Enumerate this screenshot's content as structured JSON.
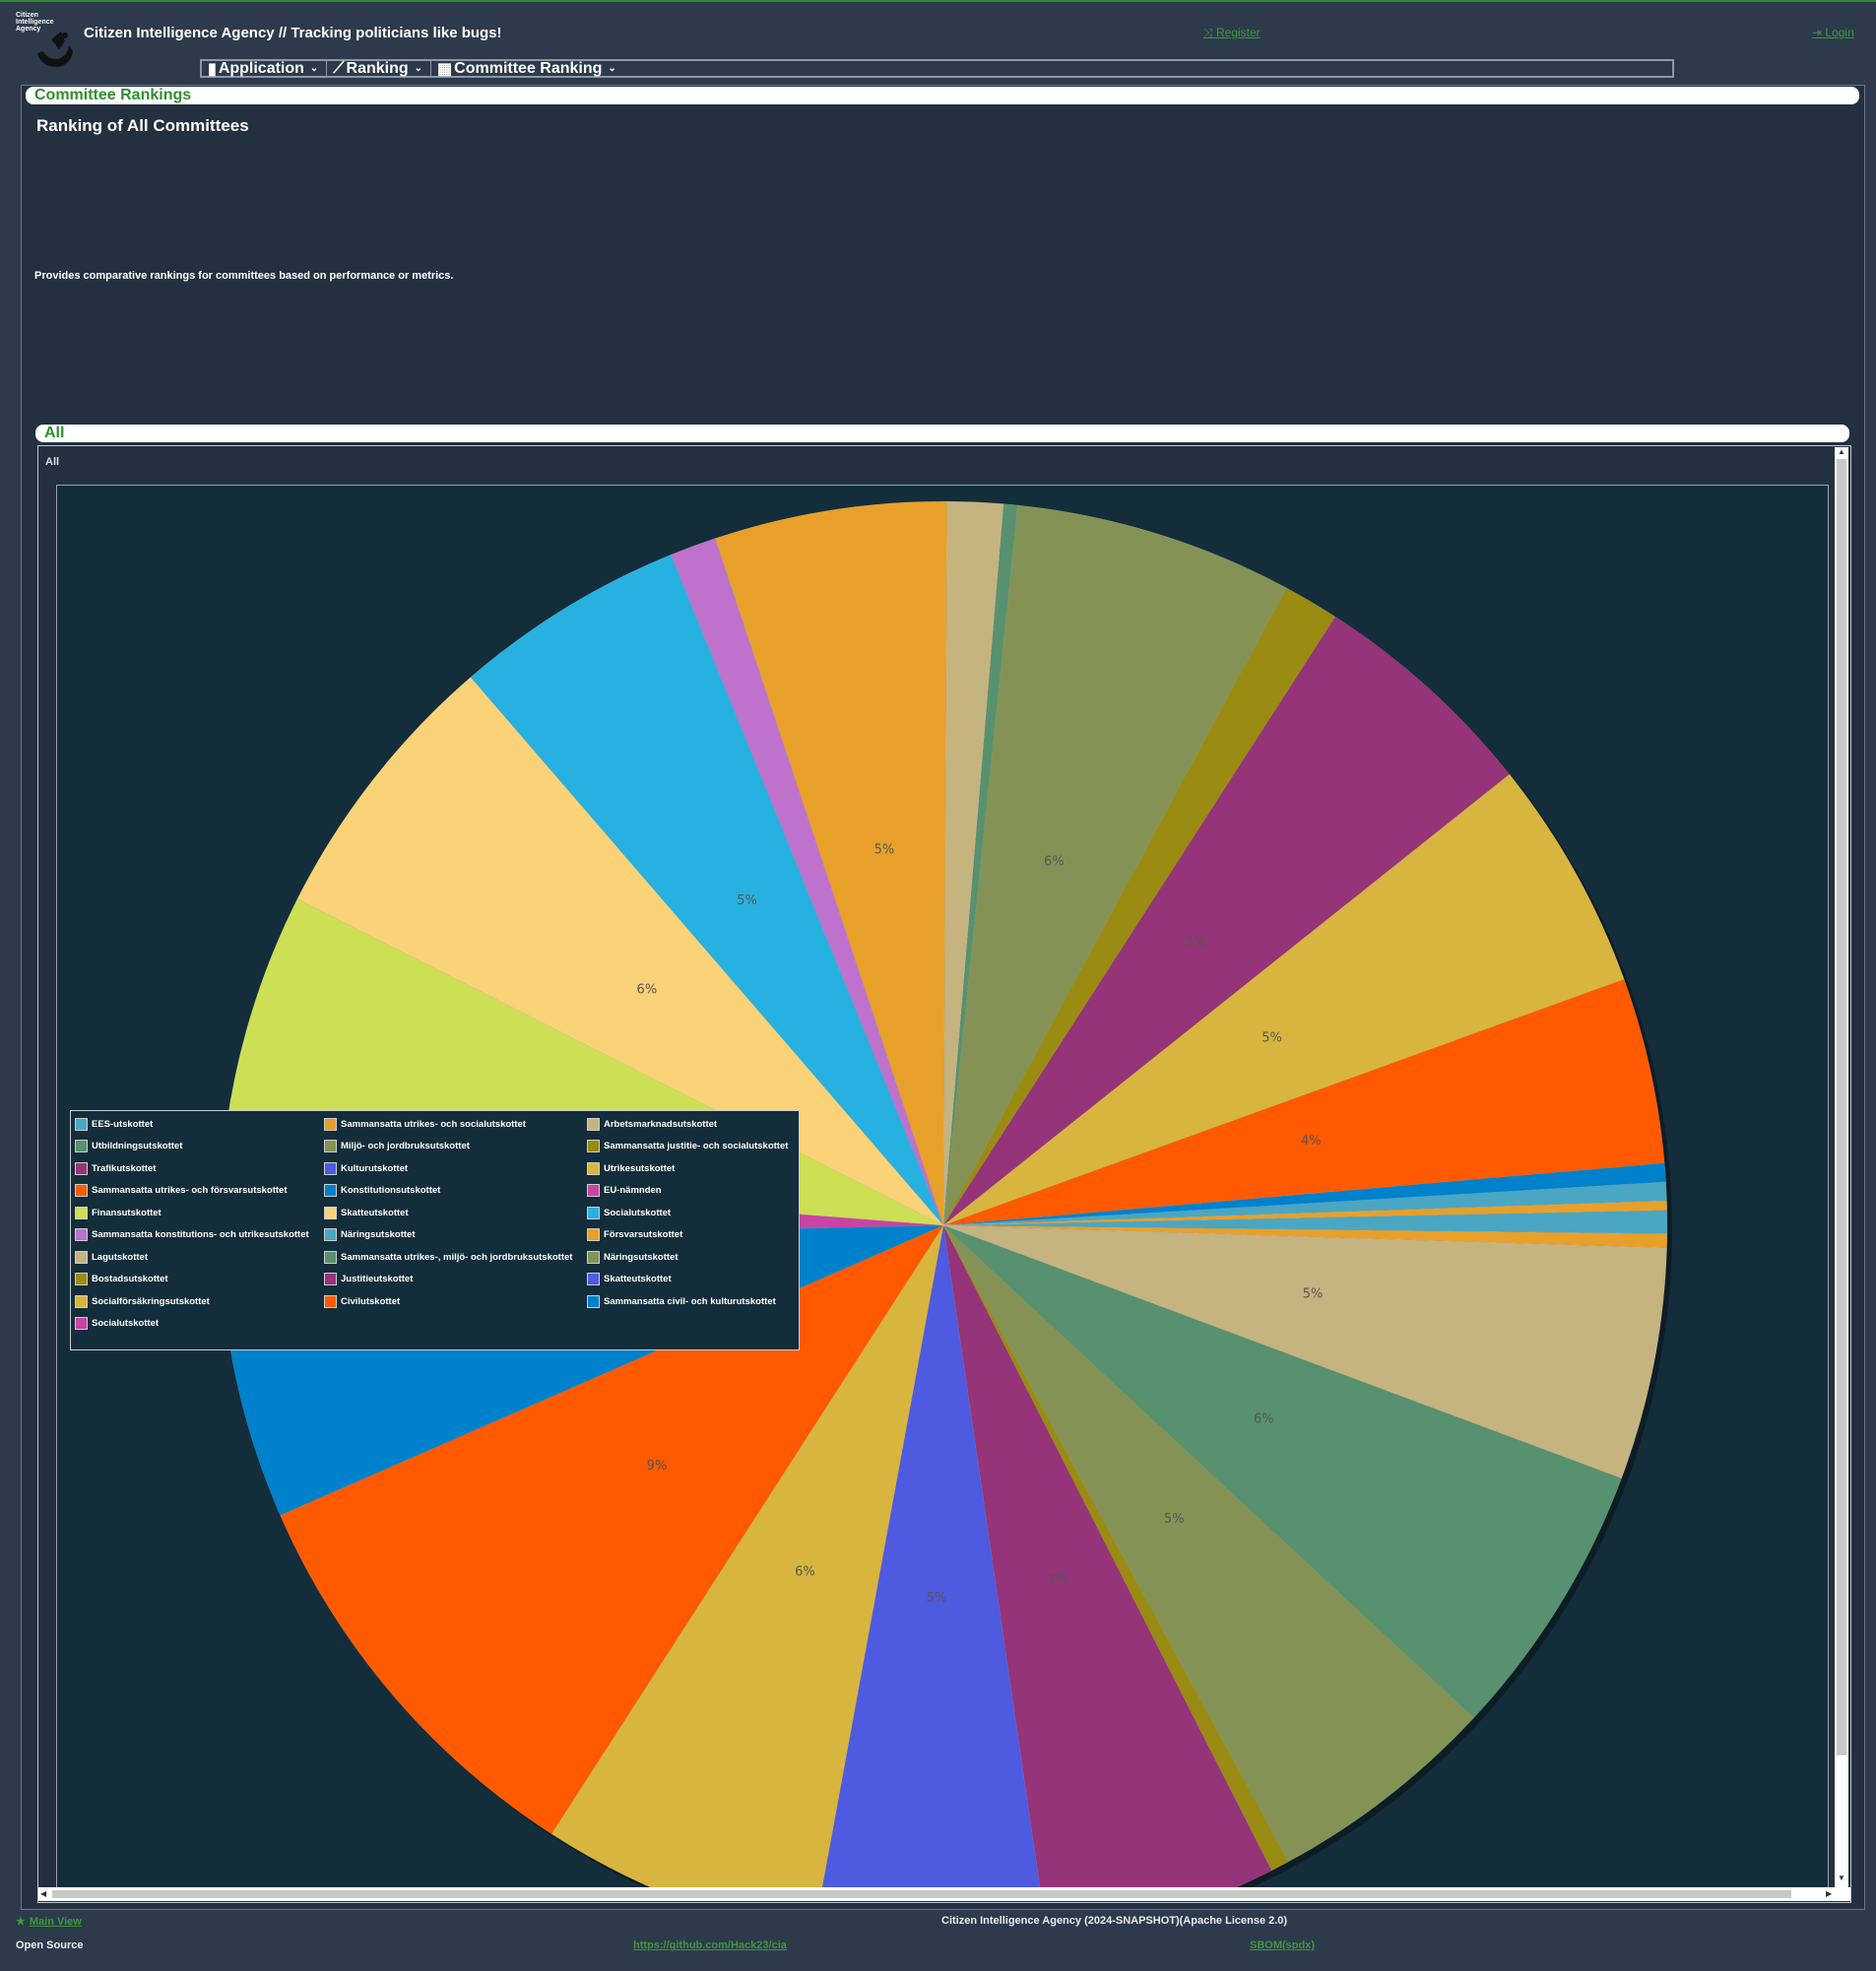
{
  "header": {
    "logo_text": "Citizen Intelligence Agency",
    "title": "Citizen Intelligence Agency",
    "tagline": " // Tracking politicians like bugs!",
    "register_label": "Register",
    "login_label": "Login"
  },
  "menu": [
    {
      "label": "Application",
      "icon": "document-icon"
    },
    {
      "label": "Ranking",
      "icon": "line-chart-icon"
    },
    {
      "label": "Committee Ranking",
      "icon": "building-icon"
    }
  ],
  "main": {
    "panel_caption": "Committee Rankings",
    "heading": "Ranking of All Committees",
    "description": "Provides comparative rankings for committees based on performance or metrics.",
    "chart_panel_caption": "All",
    "chart_label": "All"
  },
  "chart_data": {
    "type": "pie",
    "slices": [
      {
        "name": "EES-utskottet",
        "value": 0.5,
        "color": "#4aa6c2"
      },
      {
        "name": "Sammansatta utrikes- och socialutskottet",
        "value": 0.3,
        "color": "#e8a02a"
      },
      {
        "name": "Arbetsmarknadsutskottet",
        "value": 5,
        "color": "#c5b380",
        "label": "5%"
      },
      {
        "name": "Utbildningsutskottet",
        "value": 6,
        "color": "#57916f",
        "label": "6%"
      },
      {
        "name": "Miljö- och jordbruksutskottet",
        "value": 5,
        "color": "#849355",
        "label": "5%"
      },
      {
        "name": "Sammansatta justitie- och socialutskottet",
        "value": 0.4,
        "color": "#9a8b12"
      },
      {
        "name": "Trafikutskottet",
        "value": 5,
        "color": "#953478",
        "label": "5%"
      },
      {
        "name": "Kulturutskottet",
        "value": 5,
        "color": "#4e5ae0",
        "label": "5%"
      },
      {
        "name": "Utrikesutskottet",
        "value": 6,
        "color": "#d8b53e",
        "label": "6%"
      },
      {
        "name": "Sammansatta utrikes- och försvarsutskottet",
        "value": 9,
        "color": "#ff5a00",
        "label": "9%"
      },
      {
        "name": "Konstitutionsutskottet",
        "value": 6,
        "color": "#0081cc"
      },
      {
        "name": "EU-nämnden",
        "value": 1.5,
        "color": "#c944a4"
      },
      {
        "name": "Finansutskottet",
        "value": 6,
        "color": "#cddf55",
        "label": "6%"
      },
      {
        "name": "Skatteutskottet",
        "value": 6,
        "color": "#fad277",
        "label": "6%"
      },
      {
        "name": "Socialutskottet",
        "value": 5,
        "color": "#27b1e0",
        "label": "5%"
      },
      {
        "name": "Sammansatta konstitutions- och utrikesutskottet",
        "value": 1,
        "color": "#be72cc"
      },
      {
        "name": "Näringsutskottet",
        "value": 5,
        "color": "#e8a02a",
        "label": "5%"
      },
      {
        "name": "Försvarsutskottet",
        "value": 1.2,
        "color": "#c5b380"
      },
      {
        "name": "Lagutskottet",
        "value": 0.3,
        "color": "#57916f"
      },
      {
        "name": "Sammansatta utrikes-, miljö- och jordbruksutskottet",
        "value": 6,
        "color": "#849355",
        "label": "6%"
      },
      {
        "name": "Näringsutskottet",
        "value": 1.2,
        "color": "#9a8b12"
      },
      {
        "name": "Bostadsutskottet",
        "value": 5,
        "color": "#953478",
        "label": "5%"
      },
      {
        "name": "Justitieutskottet",
        "value": 5,
        "color": "#d8b53e",
        "label": "5%"
      },
      {
        "name": "Skatteutskottet",
        "value": 4,
        "color": "#ff5a00",
        "label": "4%"
      },
      {
        "name": "Socialförsäkringsutskottet",
        "value": 0.4,
        "color": "#0081cc"
      },
      {
        "name": "Civilutskottet",
        "value": 0.4,
        "color": "#4aa6c2"
      },
      {
        "name": "Sammansatta civil- och kulturutskottet",
        "value": 0.2,
        "color": "#e8a02a"
      }
    ],
    "legend": [
      {
        "name": "EES-utskottet",
        "color": "#4aa6c2"
      },
      {
        "name": "Sammansatta utrikes- och socialutskottet",
        "color": "#e8a02a"
      },
      {
        "name": "Arbetsmarknadsutskottet",
        "color": "#c5b380"
      },
      {
        "name": "Utbildningsutskottet",
        "color": "#57916f"
      },
      {
        "name": "Miljö- och jordbruksutskottet",
        "color": "#849355"
      },
      {
        "name": "Sammansatta justitie- och socialutskottet",
        "color": "#9a8b12"
      },
      {
        "name": "Trafikutskottet",
        "color": "#953478"
      },
      {
        "name": "Kulturutskottet",
        "color": "#4e5ae0"
      },
      {
        "name": "Utrikesutskottet",
        "color": "#d8b53e"
      },
      {
        "name": "Sammansatta utrikes- och försvarsutskottet",
        "color": "#ff5a00"
      },
      {
        "name": "Konstitutionsutskottet",
        "color": "#0081cc"
      },
      {
        "name": "EU-nämnden",
        "color": "#c944a4"
      },
      {
        "name": "Finansutskottet",
        "color": "#cddf55"
      },
      {
        "name": "Skatteutskottet",
        "color": "#fad277"
      },
      {
        "name": "Socialutskottet",
        "color": "#27b1e0"
      },
      {
        "name": "Sammansatta konstitutions- och utrikesutskottet",
        "color": "#be72cc"
      },
      {
        "name": "Näringsutskottet",
        "color": "#4aa6c2"
      },
      {
        "name": "Försvarsutskottet",
        "color": "#e8a02a"
      },
      {
        "name": "Lagutskottet",
        "color": "#c5b380"
      },
      {
        "name": "Sammansatta utrikes-, miljö- och jordbruksutskottet",
        "color": "#57916f"
      },
      {
        "name": "Näringsutskottet",
        "color": "#849355"
      },
      {
        "name": "Bostadsutskottet",
        "color": "#9a8b12"
      },
      {
        "name": "Justitieutskottet",
        "color": "#953478"
      },
      {
        "name": "Skatteutskottet",
        "color": "#4e5ae0"
      },
      {
        "name": "Socialförsäkringsutskottet",
        "color": "#d8b53e"
      },
      {
        "name": "Civilutskottet",
        "color": "#ff5a00"
      },
      {
        "name": "Sammansatta civil- och kulturutskottet",
        "color": "#0081cc"
      },
      {
        "name": "Socialutskottet",
        "color": "#c944a4"
      }
    ],
    "legend_placement": "left"
  },
  "footer": {
    "main_view_label": "Main View",
    "center_text": "Citizen Intelligence Agency (2024-SNAPSHOT)(Apache License 2.0)",
    "open_source_label": "Open Source",
    "github_link": "https://github.com/Hack23/cia",
    "sbom_link": "SBOM(spdx)"
  },
  "colors": {
    "background": "#2d3a4b",
    "panel": "#233040",
    "plot_background": "#142d3b",
    "link_green": "#3c9a3c"
  }
}
